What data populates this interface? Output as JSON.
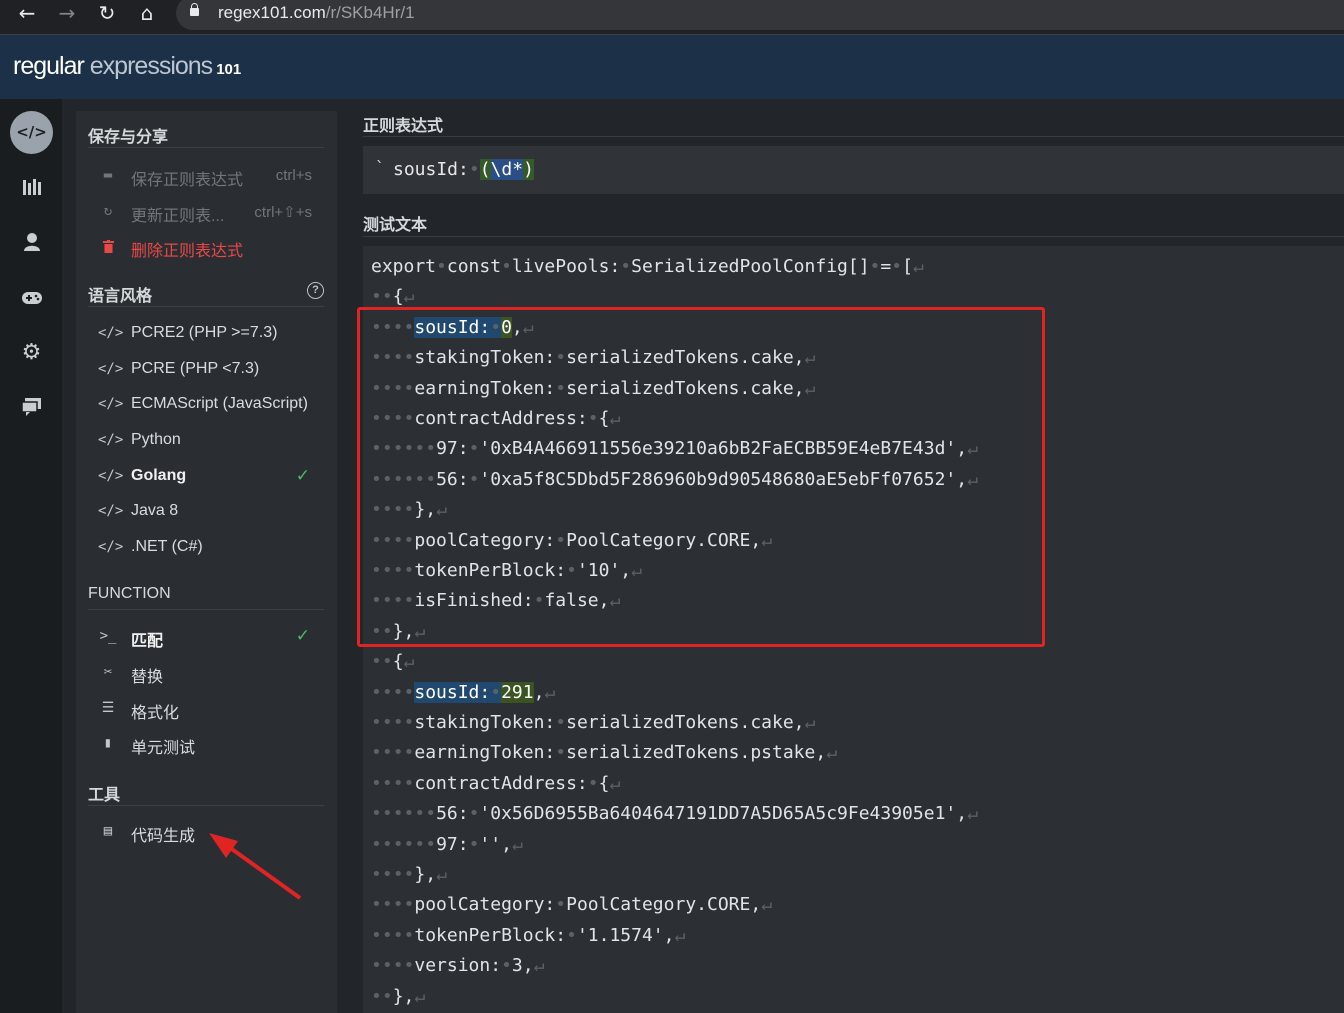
{
  "browser": {
    "back_icon": "arrow-left",
    "forward_icon": "arrow-right",
    "reload_icon": "reload",
    "home_icon": "home",
    "url_host": "regex101.com",
    "url_path": "/r/SKb4Hr/1"
  },
  "app": {
    "logo_w1": "regular",
    "logo_w2": "expressions",
    "logo_w3": "101"
  },
  "iconbar": [
    "code-icon",
    "library-icon",
    "user-icon",
    "gamepad-icon",
    "settings-icon",
    "chat-icon"
  ],
  "panel": {
    "save_share": {
      "header": "保存与分享",
      "items": [
        {
          "icon": "save-icon",
          "label": "保存正则表达式",
          "shortcut": "ctrl+s"
        },
        {
          "icon": "refresh-icon",
          "label": "更新正则表...",
          "shortcut": "ctrl+⇧+s"
        },
        {
          "icon": "trash-icon",
          "label": "删除正则表达式",
          "shortcut": ""
        }
      ]
    },
    "flavor": {
      "header": "语言风格",
      "items": [
        {
          "label": "PCRE2 (PHP >=7.3)"
        },
        {
          "label": "PCRE (PHP <7.3)"
        },
        {
          "label": "ECMAScript (JavaScript)"
        },
        {
          "label": "Python"
        },
        {
          "label": "Golang",
          "selected": true
        },
        {
          "label": "Java 8"
        },
        {
          "label": ".NET (C#)"
        }
      ]
    },
    "function": {
      "header": "FUNCTION",
      "items": [
        {
          "label": "匹配",
          "selected": true
        },
        {
          "label": "替换"
        },
        {
          "label": "格式化"
        },
        {
          "label": "单元测试"
        }
      ]
    },
    "tools": {
      "header": "工具",
      "items": [
        {
          "label": "代码生成"
        }
      ]
    }
  },
  "main": {
    "regex_label": "正则表达式",
    "regex_delim": "`",
    "regex_literal": "sousId:",
    "regex_group_open": "(",
    "regex_escape": "\\d*",
    "regex_group_close": ")",
    "test_label": "测试文本",
    "lines": [
      "export•const•livePools:•SerializedPoolConfig[]•=•[↵",
      "••{↵",
      "••••sousId:•0,↵",
      "••••stakingToken:•serializedTokens.cake,↵",
      "••••earningToken:•serializedTokens.cake,↵",
      "••••contractAddress:•{↵",
      "••••••97:•'0xB4A466911556e39210a6bB2FaECBB59E4eB7E43d',↵",
      "••••••56:•'0xa5f8C5Dbd5F286960b9d90548680aE5ebFf07652',↵",
      "••••},↵",
      "••••poolCategory:•PoolCategory.CORE,↵",
      "••••tokenPerBlock:•'10',↵",
      "••••isFinished:•false,↵",
      "••},↵",
      "••{↵",
      "••••sousId:•291,↵",
      "••••stakingToken:•serializedTokens.cake,↵",
      "••••earningToken:•serializedTokens.pstake,↵",
      "••••contractAddress:•{↵",
      "••••••56:•'0x56D6955Ba6404647191DD7A5D65A5c9Fe43905e1',↵",
      "••••••97:•'',↵",
      "••••},↵",
      "••••poolCategory:•PoolCategory.CORE,↵",
      "••••tokenPerBlock:•'1.1574',↵",
      "••••version:•3,↵",
      "••},↵"
    ]
  },
  "colors": {
    "match_full": "#21496f",
    "match_group": "#3c5422",
    "annotation_red": "#e02424",
    "check_green": "#4cbd63"
  }
}
